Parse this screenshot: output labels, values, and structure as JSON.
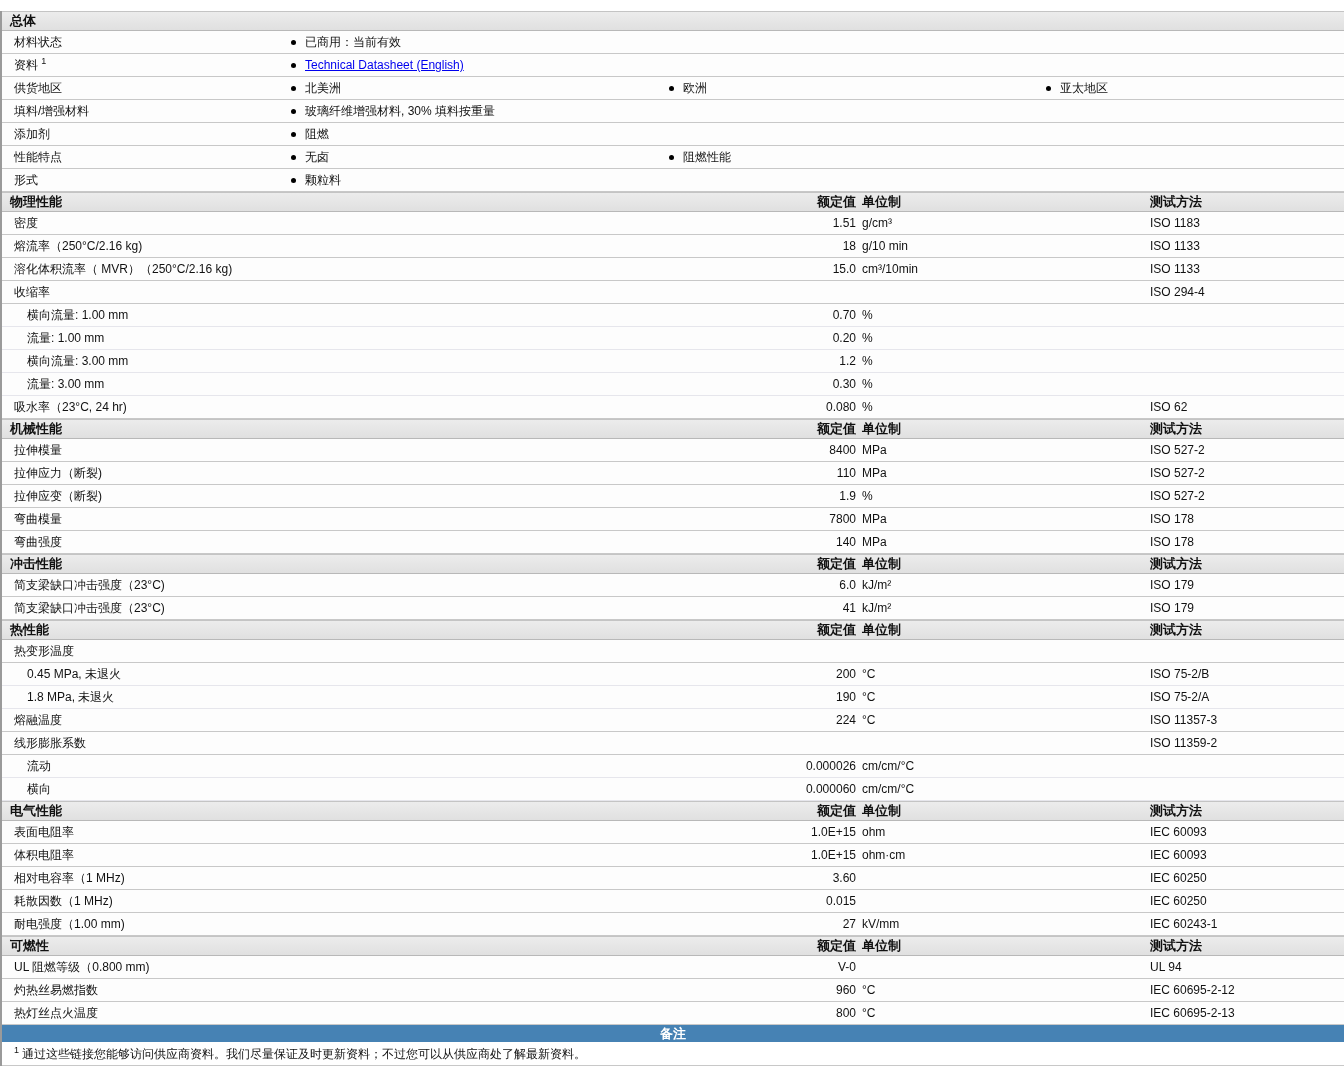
{
  "sections": [
    {
      "title": "总体",
      "kind": "general",
      "rows": [
        {
          "label": "材料状态",
          "items": [
            {
              "kind": "text",
              "text": "已商用：当前有效"
            }
          ]
        },
        {
          "label": "资料 $^{1}$",
          "items": [
            {
              "kind": "link",
              "text": "Technical Datasheet (English)"
            }
          ]
        },
        {
          "label": "供货地区",
          "items": [
            {
              "kind": "text",
              "text": "北美洲"
            },
            {
              "kind": "text",
              "text": "欧洲"
            },
            {
              "kind": "text",
              "text": "亚太地区"
            }
          ]
        },
        {
          "label": "填料/增强材料",
          "items": [
            {
              "kind": "text",
              "text": "玻璃纤维增强材料, 30% 填料按重量"
            }
          ]
        },
        {
          "label": "添加剂",
          "items": [
            {
              "kind": "text",
              "text": "阻燃"
            }
          ]
        },
        {
          "label": "性能特点",
          "items": [
            {
              "kind": "text",
              "text": "无卤"
            },
            {
              "kind": "text",
              "text": "阻燃性能"
            }
          ]
        },
        {
          "label": "形式",
          "items": [
            {
              "kind": "text",
              "text": "颗粒料"
            }
          ]
        }
      ]
    },
    {
      "title": "物理性能",
      "kind": "properties",
      "columns": [
        "额定值",
        "单位制",
        "测试方法"
      ],
      "rows": [
        {
          "label": "密度",
          "value": "1.51",
          "unit": "g/cm³",
          "method": "ISO 1183"
        },
        {
          "label": "熔流率（250°C/2.16 kg)",
          "value": "18",
          "unit": "g/10 min",
          "method": "ISO 1133"
        },
        {
          "label": "溶化体积流率（ MVR）（250°C/2.16 kg)",
          "value": "15.0",
          "unit": "cm³/10min",
          "method": "ISO 1133"
        },
        {
          "label": "收缩率",
          "method": "ISO 294-4",
          "children": [
            {
              "label": "横向流量: 1.00 mm",
              "value": "0.70",
              "unit": "%"
            },
            {
              "label": "流量: 1.00 mm",
              "value": "0.20",
              "unit": "%"
            },
            {
              "label": "横向流量: 3.00 mm",
              "value": "1.2",
              "unit": "%"
            },
            {
              "label": "流量: 3.00 mm",
              "value": "0.30",
              "unit": "%"
            }
          ]
        },
        {
          "label": "吸水率（23°C, 24 hr)",
          "value": "0.080",
          "unit": "%",
          "method": "ISO 62"
        }
      ]
    },
    {
      "title": "机械性能",
      "kind": "properties",
      "columns": [
        "额定值",
        "单位制",
        "测试方法"
      ],
      "rows": [
        {
          "label": "拉伸模量",
          "value": "8400",
          "unit": "MPa",
          "method": "ISO 527-2"
        },
        {
          "label": "拉伸应力（断裂)",
          "value": "110",
          "unit": "MPa",
          "method": "ISO 527-2"
        },
        {
          "label": "拉伸应变（断裂)",
          "value": "1.9",
          "unit": "%",
          "method": "ISO 527-2"
        },
        {
          "label": "弯曲模量",
          "value": "7800",
          "unit": "MPa",
          "method": "ISO 178"
        },
        {
          "label": "弯曲强度",
          "value": "140",
          "unit": "MPa",
          "method": "ISO 178"
        }
      ]
    },
    {
      "title": "冲击性能",
      "kind": "properties",
      "columns": [
        "额定值",
        "单位制",
        "测试方法"
      ],
      "rows": [
        {
          "label": "简支梁缺口冲击强度（23°C)",
          "value": "6.0",
          "unit": "kJ/m²",
          "method": "ISO 179"
        },
        {
          "label": "简支梁缺口冲击强度（23°C)",
          "value": "41",
          "unit": "kJ/m²",
          "method": "ISO 179"
        }
      ]
    },
    {
      "title": "热性能",
      "kind": "properties",
      "columns": [
        "额定值",
        "单位制",
        "测试方法"
      ],
      "rows": [
        {
          "label": "热变形温度",
          "children": [
            {
              "label": "0.45 MPa, 未退火",
              "value": "200",
              "unit": "°C",
              "method": "ISO 75-2/B"
            },
            {
              "label": "1.8 MPa, 未退火",
              "value": "190",
              "unit": "°C",
              "method": "ISO 75-2/A"
            }
          ]
        },
        {
          "label": "熔融温度",
          "value": "224",
          "unit": "°C",
          "method": "ISO 11357-3"
        },
        {
          "label": "线形膨胀系数",
          "method": "ISO 11359-2",
          "children": [
            {
              "label": "流动",
              "value": "0.000026",
              "unit": "cm/cm/°C"
            },
            {
              "label": "横向",
              "value": "0.000060",
              "unit": "cm/cm/°C"
            }
          ]
        }
      ]
    },
    {
      "title": "电气性能",
      "kind": "properties",
      "columns": [
        "额定值",
        "单位制",
        "测试方法"
      ],
      "rows": [
        {
          "label": "表面电阻率",
          "value": "1.0E+15",
          "unit": "ohm",
          "method": "IEC 60093"
        },
        {
          "label": "体积电阻率",
          "value": "1.0E+15",
          "unit": "ohm·cm",
          "method": "IEC 60093"
        },
        {
          "label": "相对电容率（1 MHz)",
          "value": "3.60",
          "method": "IEC 60250"
        },
        {
          "label": "耗散因数（1 MHz)",
          "value": "0.015",
          "method": "IEC 60250"
        },
        {
          "label": "耐电强度（1.00 mm)",
          "value": "27",
          "unit": "kV/mm",
          "method": "IEC 60243-1"
        }
      ]
    },
    {
      "title": "可燃性",
      "kind": "properties",
      "columns": [
        "额定值",
        "单位制",
        "测试方法"
      ],
      "rows": [
        {
          "label": "UL 阻燃等级（0.800 mm)",
          "value": "V-0",
          "method": "UL 94"
        },
        {
          "label": "灼热丝易燃指数",
          "value": "960",
          "unit": "°C",
          "method": "IEC 60695-2-12"
        },
        {
          "label": "热灯丝点火温度",
          "value": "800",
          "unit": "°C",
          "method": "IEC 60695-2-13"
        }
      ]
    }
  ],
  "notes": {
    "title": "备注",
    "text": "$^{1}$ 通过这些链接您能够访问供应商资料。我们尽量保证及时更新资料；不过您可以从供应商处了解最新资料。"
  }
}
